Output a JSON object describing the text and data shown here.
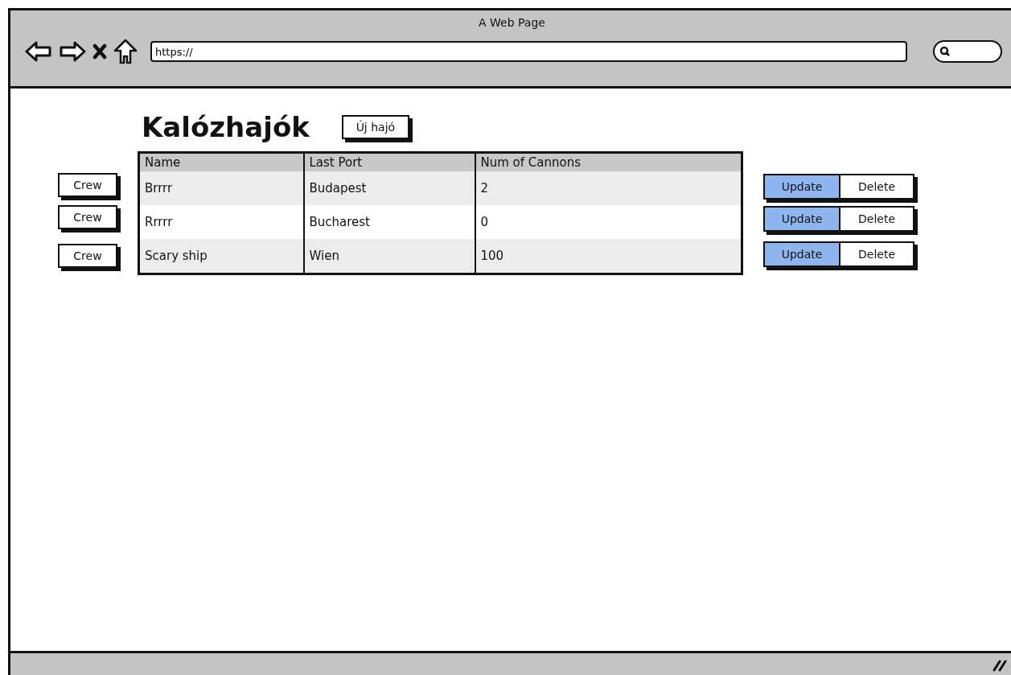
{
  "window": {
    "title": "A Web Page"
  },
  "address_bar": {
    "value": "https://"
  },
  "heading": "Kalózhajók",
  "new_button": "Új hajó",
  "table": {
    "columns": [
      "Name",
      "Last Port",
      "Num of Cannons"
    ],
    "rows": [
      {
        "cells": [
          "Brrrr",
          "Budapest",
          "2"
        ],
        "crew_button": "Crew",
        "actions": [
          {
            "label": "Update",
            "selected": true
          },
          {
            "label": "Delete",
            "selected": false
          }
        ]
      },
      {
        "cells": [
          "Rrrrr",
          "Bucharest",
          "0"
        ],
        "crew_button": "Crew",
        "actions": [
          {
            "label": "Update",
            "selected": true
          },
          {
            "label": "Delete",
            "selected": false
          }
        ]
      },
      {
        "cells": [
          "Scary ship",
          "Wien",
          "100"
        ],
        "crew_button": "Crew",
        "actions": [
          {
            "label": "Update",
            "selected": true
          },
          {
            "label": "Delete",
            "selected": false
          }
        ]
      }
    ]
  }
}
